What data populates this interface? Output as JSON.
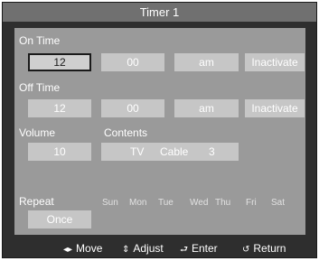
{
  "title": "Timer 1",
  "on_time": {
    "label": "On Time",
    "hour": "12",
    "minute": "00",
    "ampm": "am",
    "status": "Inactivate"
  },
  "off_time": {
    "label": "Off Time",
    "hour": "12",
    "minute": "00",
    "ampm": "am",
    "status": "Inactivate"
  },
  "volume": {
    "label": "Volume",
    "value": "10"
  },
  "contents": {
    "label": "Contents",
    "source": "TV",
    "antenna": "Cable",
    "channel": "3"
  },
  "repeat": {
    "label": "Repeat",
    "value": "Once",
    "days": [
      "Sun",
      "Mon",
      "Tue",
      "Wed",
      "Thu",
      "Fri",
      "Sat"
    ]
  },
  "nav": {
    "move": "Move",
    "adjust": "Adjust",
    "enter": "Enter",
    "return": "Return"
  },
  "icons": {
    "move": "left-right-arrows-icon",
    "adjust": "up-down-arrows-icon",
    "enter": "enter-icon",
    "return": "return-icon"
  }
}
